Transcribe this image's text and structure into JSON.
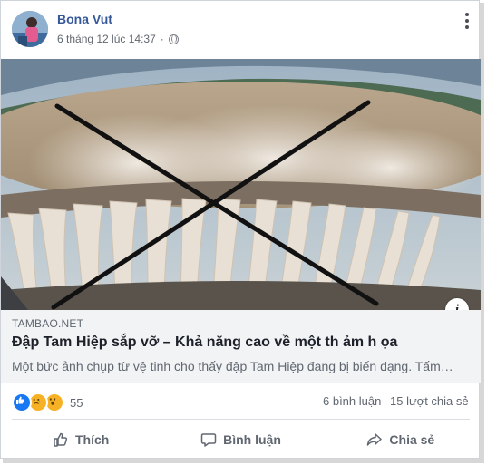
{
  "post": {
    "author": "Bona Vut",
    "timestamp": "6 tháng 12 lúc 14:37",
    "privacy_icon": "globe-icon"
  },
  "link": {
    "domain": "TAMBAO.NET",
    "title": "Đập Tam Hiệp sắp vỡ – Khả năng cao về một th ảm h ọa",
    "description": "Một bức ảnh chụp từ vệ tinh cho thấy đập Tam Hiệp đang bị biến dạng. Tấm…",
    "info_glyph": "i"
  },
  "stats": {
    "reactions": [
      "like",
      "sad",
      "wow"
    ],
    "reaction_count": "55",
    "comments": "6 bình luận",
    "shares": "15 lượt chia sẻ"
  },
  "actions": {
    "like": "Thích",
    "comment": "Bình luận",
    "share": "Chia sẻ"
  },
  "colors": {
    "author_link": "#365899",
    "like_blue": "#1877f2",
    "reaction_yellow": "#f7b125"
  }
}
